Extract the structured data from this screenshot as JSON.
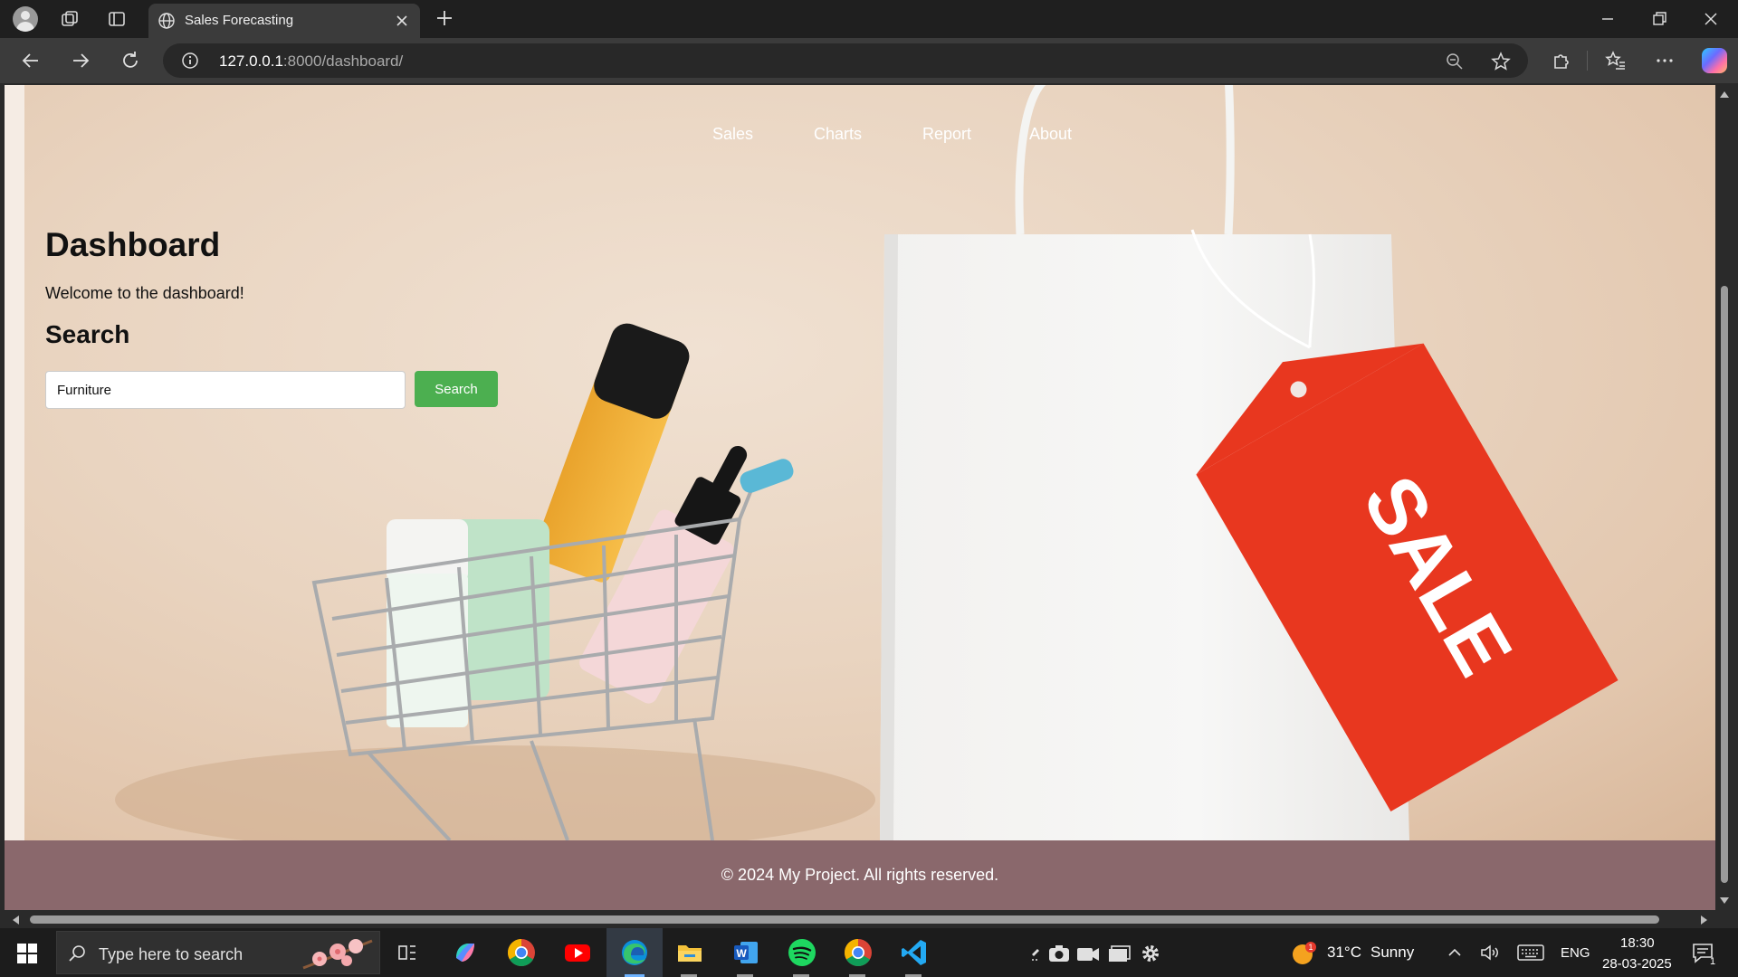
{
  "browser": {
    "tab_title": "Sales Forecasting",
    "url_host": "127.0.0.1",
    "url_rest": ":8000/dashboard/"
  },
  "nav": {
    "links": [
      "Sales",
      "Charts",
      "Report",
      "About"
    ]
  },
  "main": {
    "heading": "Dashboard",
    "welcome": "Welcome to the dashboard!",
    "search_heading": "Search",
    "search_value": "Furniture",
    "search_button": "Search"
  },
  "hero_image": {
    "tag_text": "SALE"
  },
  "footer": {
    "copyright": "© 2024 My Project. All rights reserved."
  },
  "taskbar": {
    "search_placeholder": "Type here to search",
    "weather_temp": "31°C",
    "weather_desc": "Sunny",
    "language": "ENG",
    "time": "18:30",
    "date": "28-03-2025",
    "notification_count": "1",
    "weather_badge": "1"
  },
  "colors": {
    "search_button": "#4caf50",
    "footer": "#8a686c",
    "sale_tag": "#e8371f"
  }
}
